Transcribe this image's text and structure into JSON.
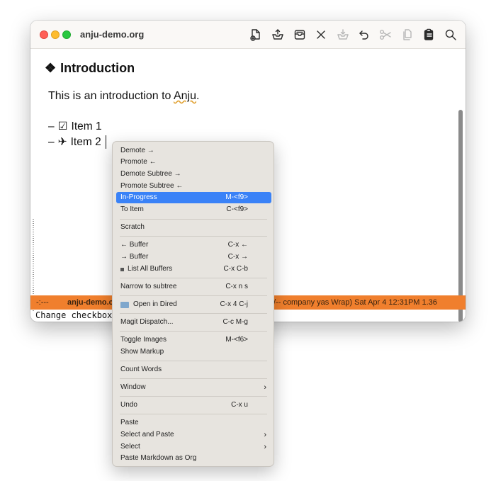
{
  "window": {
    "title": "anju-demo.org"
  },
  "toolbar": {
    "icons": [
      "new-file-icon",
      "export-icon",
      "archive-icon",
      "close-icon",
      "import-icon",
      "undo-icon",
      "cut-icon",
      "copy-icon",
      "paste-icon",
      "search-icon"
    ]
  },
  "document": {
    "heading_glyph": "❖",
    "heading": "Introduction",
    "para_before": "This is an introduction to ",
    "para_link": "Anju",
    "para_after": ".",
    "items": [
      {
        "bullet": "–",
        "glyph": "☑",
        "text": "Item 1"
      },
      {
        "bullet": "–",
        "glyph": "✈",
        "text": "Item 2"
      }
    ]
  },
  "modeline": {
    "left": "-:---",
    "buffer": "anju-demo.c",
    "right": "/-- company yas Wrap)  Sat Apr  4 12:31PM 1.36",
    "color": "#f07f2d"
  },
  "echo": "Change checkbox",
  "context_menu": {
    "highlight_color": "#3a82f7",
    "items": [
      {
        "label": "Demote →",
        "shortcut": ""
      },
      {
        "label": "Promote ←",
        "shortcut": ""
      },
      {
        "label": "Demote Subtree →",
        "shortcut": ""
      },
      {
        "label": "Promote Subtree ←",
        "shortcut": ""
      },
      {
        "label": "In-Progress",
        "shortcut": "M-<f9>"
      },
      {
        "label": "To Item",
        "shortcut": "C-<f9>"
      },
      {
        "label": "Scratch",
        "shortcut": ""
      },
      {
        "label": "← Buffer",
        "shortcut": "C-x ←"
      },
      {
        "label": "→ Buffer",
        "shortcut": "C-x →"
      },
      {
        "label": "List All Buffers",
        "shortcut": "C-x C-b"
      },
      {
        "label": "Narrow to subtree",
        "shortcut": "C-x n s"
      },
      {
        "label": "Open in Dired",
        "shortcut": "C-x 4 C-j"
      },
      {
        "label": "Magit Dispatch...",
        "shortcut": "C-c M-g"
      },
      {
        "label": "Toggle Images",
        "shortcut": "M-<f6>"
      },
      {
        "label": "Show Markup",
        "shortcut": ""
      },
      {
        "label": "Count Words",
        "shortcut": ""
      },
      {
        "label": "Window",
        "shortcut": "",
        "submenu": "›"
      },
      {
        "label": "Undo",
        "shortcut": "C-x u"
      },
      {
        "label": "Paste",
        "shortcut": ""
      },
      {
        "label": "Select and Paste",
        "shortcut": "",
        "submenu": "›"
      },
      {
        "label": "Select",
        "shortcut": "",
        "submenu": "›"
      },
      {
        "label": "Paste Markdown as Org",
        "shortcut": ""
      }
    ]
  }
}
